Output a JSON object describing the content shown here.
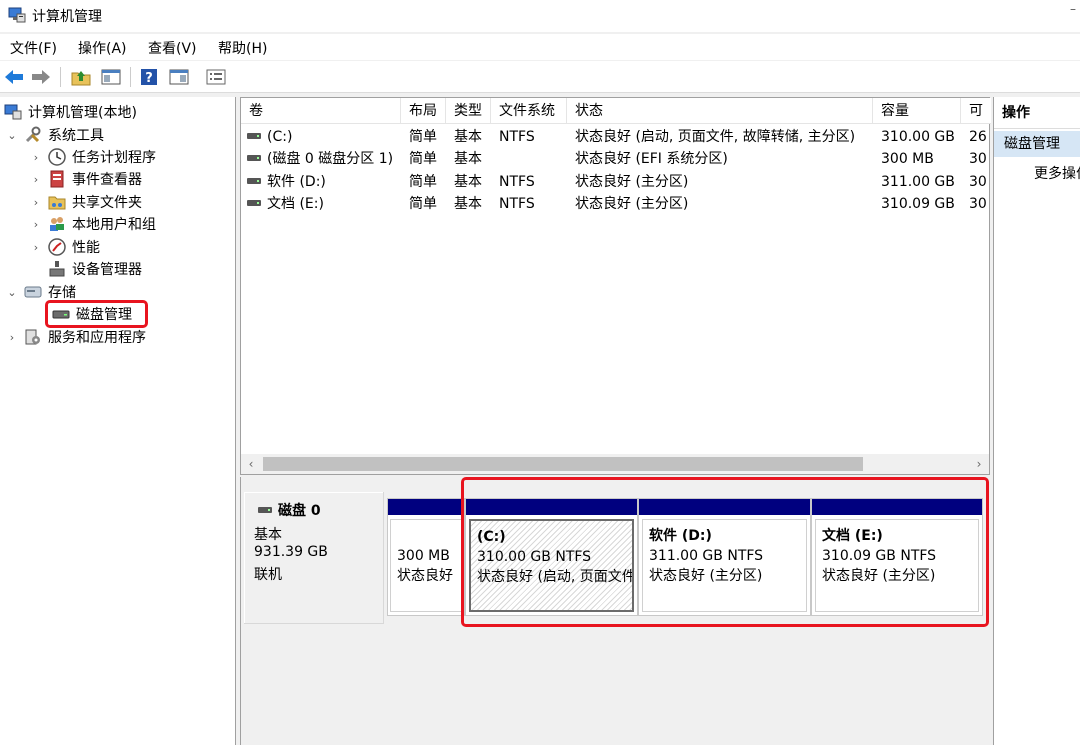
{
  "window": {
    "title": "计算机管理"
  },
  "menu": [
    "文件(F)",
    "操作(A)",
    "查看(V)",
    "帮助(H)"
  ],
  "toolbar_icons": [
    "back-icon",
    "forward-icon",
    "up-folder-icon",
    "show-hide-tree-icon",
    "help-icon",
    "show-action-pane-icon",
    "properties-icon"
  ],
  "tree": {
    "root": "计算机管理(本地)",
    "system_tools": "系统工具",
    "task_scheduler": "任务计划程序",
    "event_viewer": "事件查看器",
    "shared_folders": "共享文件夹",
    "local_users": "本地用户和组",
    "performance": "性能",
    "device_manager": "设备管理器",
    "storage": "存储",
    "disk_management": "磁盘管理",
    "services_apps": "服务和应用程序"
  },
  "volumes": {
    "columns": [
      "卷",
      "布局",
      "类型",
      "文件系统",
      "状态",
      "容量",
      "可"
    ],
    "rows": [
      {
        "volume": "(C:)",
        "layout": "简单",
        "type": "基本",
        "fs": "NTFS",
        "status": "状态良好 (启动, 页面文件, 故障转储, 主分区)",
        "capacity": "310.00 GB",
        "free": "26"
      },
      {
        "volume": "(磁盘 0 磁盘分区 1)",
        "layout": "简单",
        "type": "基本",
        "fs": "",
        "status": "状态良好 (EFI 系统分区)",
        "capacity": "300 MB",
        "free": "30"
      },
      {
        "volume": "软件 (D:)",
        "layout": "简单",
        "type": "基本",
        "fs": "NTFS",
        "status": "状态良好 (主分区)",
        "capacity": "311.00 GB",
        "free": "30"
      },
      {
        "volume": "文档 (E:)",
        "layout": "简单",
        "type": "基本",
        "fs": "NTFS",
        "status": "状态良好 (主分区)",
        "capacity": "310.09 GB",
        "free": "30"
      }
    ]
  },
  "disk": {
    "name": "磁盘 0",
    "type": "基本",
    "size": "931.39 GB",
    "state": "联机",
    "partitions": [
      {
        "title": "",
        "size": "300 MB",
        "status": "状态良好"
      },
      {
        "title": "(C:)",
        "size": "310.00 GB NTFS",
        "status": "状态良好 (启动, 页面文件"
      },
      {
        "title": "软件 (D:)",
        "size": "311.00 GB NTFS",
        "status": "状态良好 (主分区)"
      },
      {
        "title": "文档 (E:)",
        "size": "310.09 GB NTFS",
        "status": "状态良好 (主分区)"
      }
    ]
  },
  "actions": {
    "header": "操作",
    "section": "磁盘管理",
    "more": "更多操作"
  },
  "colors": {
    "partition_bar": "#00007f",
    "highlight": "#e8141f",
    "selection": "#d6e6f5"
  }
}
